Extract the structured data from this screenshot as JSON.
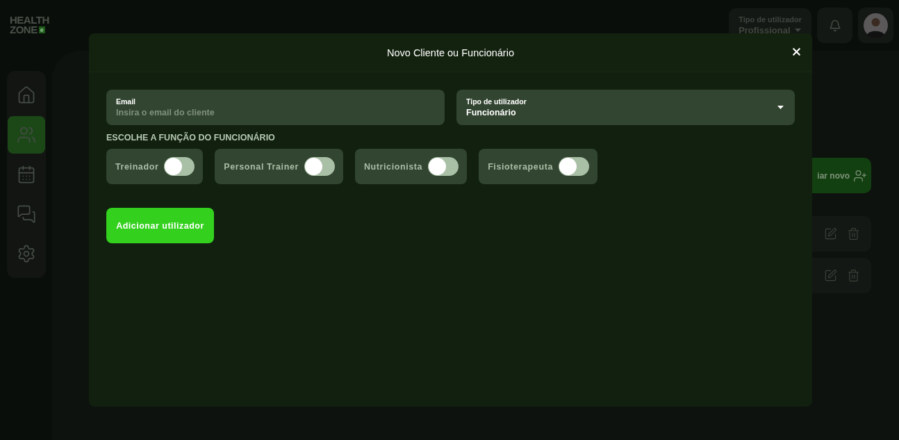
{
  "logo": {
    "line1": "HEALTH",
    "line2": "ZONE",
    "badge": "e"
  },
  "header": {
    "user_type": {
      "label": "Tipo de utilizador",
      "value": "Profissional"
    }
  },
  "sidebar": {
    "items": [
      {
        "kind": "home",
        "selected": false
      },
      {
        "kind": "users",
        "selected": true
      },
      {
        "kind": "calendar",
        "selected": false
      },
      {
        "kind": "messages",
        "selected": false
      },
      {
        "kind": "settings",
        "selected": false
      }
    ]
  },
  "main": {
    "create_button": {
      "label": "iar novo"
    },
    "rows": [
      {
        "kind": "row"
      },
      {
        "kind": "row"
      }
    ]
  },
  "modal": {
    "title": "Novo Cliente ou Funcionário",
    "fields": [
      {
        "kind": "text",
        "label": "Email",
        "placeholder": "Insira o email do cliente"
      },
      {
        "kind": "select",
        "label": "Tipo de utilizador",
        "value": "Funcionário"
      }
    ],
    "section_title": "ESCOLHE A FUNÇÃO DO FUNCIONÁRIO",
    "roles": [
      {
        "label": "Treinador",
        "on": false
      },
      {
        "label": "Personal Trainer",
        "on": false
      },
      {
        "label": "Nutricionista",
        "on": false
      },
      {
        "label": "Fisioterapeuta",
        "on": false
      }
    ],
    "submit": "Adicionar utilizador"
  }
}
